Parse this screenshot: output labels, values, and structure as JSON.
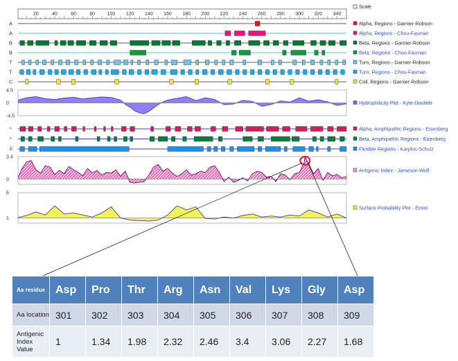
{
  "chart_data": {
    "type": "line",
    "sequence_axis": {
      "range": [
        1,
        350
      ],
      "ticks": [
        20,
        40,
        60,
        80,
        100,
        120,
        140,
        160,
        180,
        200,
        220,
        240,
        260,
        280,
        300,
        320,
        340
      ],
      "scale_label": "Scale"
    },
    "tracks": [
      {
        "letter": "A",
        "legend": "Alpha, Regions - Garnier-Robson",
        "color": "#e8141d",
        "legend_color": "#222222",
        "segments": [
          [
            253,
            258
          ]
        ]
      },
      {
        "letter": "A",
        "legend": "Alpha, Regions - Chou-Fasman",
        "color": "#e8147a",
        "legend_color": "#2b4fd6",
        "segments": [
          [
            221,
            227
          ],
          [
            231,
            242
          ],
          [
            246,
            264
          ]
        ]
      },
      {
        "letter": "B",
        "legend": "Beta, Regions - Garnier-Robson",
        "color": "#007a2e",
        "legend_color": "#222222",
        "segments": [
          [
            3,
            8
          ],
          [
            11,
            17
          ],
          [
            20,
            34
          ],
          [
            40,
            43
          ],
          [
            46,
            52
          ],
          [
            54,
            60
          ],
          [
            63,
            73
          ],
          [
            77,
            84
          ],
          [
            88,
            96
          ],
          [
            99,
            106
          ],
          [
            120,
            140
          ],
          [
            143,
            152
          ],
          [
            154,
            163
          ],
          [
            165,
            173
          ],
          [
            186,
            200
          ],
          [
            203,
            207
          ],
          [
            212,
            217
          ],
          [
            222,
            226
          ],
          [
            231,
            238
          ],
          [
            246,
            258
          ],
          [
            262,
            268
          ],
          [
            272,
            278
          ],
          [
            283,
            288
          ],
          [
            293,
            305
          ],
          [
            312,
            318
          ],
          [
            322,
            328
          ],
          [
            331,
            338
          ],
          [
            343,
            350
          ]
        ]
      },
      {
        "letter": "B",
        "legend": "Beta, Regions - Chou-Fasman",
        "color": "#0f9a3c",
        "legend_color": "#2b4fd6",
        "segments": [
          [
            120,
            137
          ],
          [
            228,
            233
          ],
          [
            236,
            248
          ],
          [
            282,
            286
          ],
          [
            291,
            307
          ],
          [
            316,
            320
          ],
          [
            324,
            327
          ]
        ]
      },
      {
        "letter": "T",
        "legend": "Turn, Regions - Garnier-Robson",
        "color": "#6cc4ee",
        "legend_color": "#222222",
        "segments": [
          [
            5,
            8
          ],
          [
            12,
            15
          ],
          [
            20,
            23
          ],
          [
            27,
            31
          ],
          [
            36,
            39
          ],
          [
            44,
            48
          ],
          [
            52,
            56
          ],
          [
            61,
            65
          ],
          [
            70,
            73
          ],
          [
            78,
            81
          ],
          [
            86,
            90
          ],
          [
            95,
            98
          ],
          [
            103,
            110
          ],
          [
            113,
            118
          ],
          [
            121,
            123
          ],
          [
            128,
            131
          ],
          [
            137,
            140
          ],
          [
            146,
            150
          ],
          [
            157,
            160
          ],
          [
            164,
            170
          ],
          [
            177,
            185
          ],
          [
            190,
            193
          ],
          [
            200,
            204
          ],
          [
            210,
            213
          ],
          [
            218,
            221
          ],
          [
            226,
            230
          ],
          [
            240,
            243
          ],
          [
            256,
            260
          ],
          [
            270,
            273
          ],
          [
            278,
            281
          ],
          [
            293,
            297
          ],
          [
            303,
            306
          ],
          [
            312,
            316
          ],
          [
            322,
            325
          ],
          [
            330,
            333
          ],
          [
            338,
            341
          ],
          [
            346,
            349
          ]
        ]
      },
      {
        "letter": "T",
        "legend": "Turn, Regions - Chou-Fasman",
        "color": "#1ea9e6",
        "legend_color": "#2b4fd6",
        "segments": [
          [
            3,
            7
          ],
          [
            10,
            14
          ],
          [
            17,
            20
          ],
          [
            24,
            29
          ],
          [
            33,
            37
          ],
          [
            40,
            44
          ],
          [
            47,
            52
          ],
          [
            55,
            60
          ],
          [
            63,
            67
          ],
          [
            71,
            75
          ],
          [
            79,
            84
          ],
          [
            87,
            90
          ],
          [
            94,
            97
          ],
          [
            100,
            108
          ],
          [
            112,
            116
          ],
          [
            119,
            124
          ],
          [
            128,
            132
          ],
          [
            136,
            140
          ],
          [
            143,
            149
          ],
          [
            153,
            158
          ],
          [
            163,
            170
          ],
          [
            174,
            178
          ],
          [
            182,
            186
          ],
          [
            190,
            193
          ],
          [
            197,
            202
          ],
          [
            206,
            210
          ],
          [
            214,
            219
          ],
          [
            223,
            228
          ],
          [
            232,
            236
          ],
          [
            240,
            244
          ],
          [
            248,
            252
          ],
          [
            256,
            260
          ],
          [
            264,
            268
          ],
          [
            272,
            276
          ],
          [
            280,
            284
          ],
          [
            288,
            292
          ],
          [
            296,
            300
          ],
          [
            304,
            308
          ],
          [
            312,
            316
          ],
          [
            320,
            324
          ],
          [
            328,
            332
          ],
          [
            336,
            340
          ],
          [
            344,
            348
          ]
        ]
      },
      {
        "letter": "C",
        "legend": "Coil, Regions - Garnier-Robson",
        "color": "#f0e43c",
        "legend_color": "#222222",
        "segments": [
          [
            9,
            12
          ],
          [
            42,
            46
          ],
          [
            58,
            62
          ],
          [
            104,
            108
          ],
          [
            162,
            166
          ],
          [
            189,
            193
          ],
          [
            224,
            228
          ],
          [
            264,
            268
          ],
          [
            290,
            294
          ],
          [
            338,
            341
          ]
        ]
      }
    ],
    "plots": [
      {
        "legend": "Hydrophilicity Plot - Kyte-Doolittle",
        "y_ticks": [
          "4.5",
          "0",
          "-4.5"
        ],
        "range": [
          -4.5,
          4.5
        ],
        "color": "#7b68ee",
        "fill": "solid",
        "x": [
          1,
          10,
          20,
          30,
          40,
          50,
          60,
          70,
          80,
          90,
          100,
          110,
          115,
          120,
          125,
          130,
          135,
          140,
          145,
          150,
          155,
          160,
          170,
          180,
          190,
          200,
          210,
          220,
          230,
          240,
          250,
          260,
          270,
          280,
          290,
          300,
          310,
          320,
          330,
          340,
          350
        ],
        "y": [
          1.0,
          1.8,
          2.2,
          1.5,
          1.2,
          1.7,
          2.0,
          1.4,
          1.8,
          2.1,
          1.9,
          1.0,
          -0.5,
          -1.5,
          -2.8,
          -3.5,
          -3.8,
          -3.0,
          -1.8,
          -0.6,
          0.4,
          1.0,
          1.6,
          2.2,
          0.8,
          1.8,
          1.2,
          -0.6,
          -0.4,
          0.9,
          0.5,
          -1.2,
          -0.6,
          0.7,
          0.3,
          1.8,
          0.6,
          1.1,
          0.4,
          -0.9,
          -0.3
        ]
      },
      {
        "legend": "Antigenic Index - Jameson-Wolf",
        "y_ticks": [
          "3.4",
          "0"
        ],
        "range": [
          -0.8,
          3.4
        ],
        "color": "#e2007a",
        "fill": "hatch",
        "x": [
          1,
          5,
          10,
          15,
          20,
          25,
          30,
          35,
          40,
          45,
          50,
          55,
          60,
          65,
          70,
          75,
          80,
          85,
          90,
          95,
          100,
          105,
          110,
          115,
          120,
          125,
          130,
          135,
          140,
          145,
          150,
          155,
          160,
          165,
          170,
          175,
          180,
          185,
          190,
          195,
          200,
          205,
          210,
          215,
          220,
          225,
          230,
          235,
          240,
          245,
          250,
          255,
          260,
          265,
          270,
          275,
          280,
          285,
          290,
          295,
          300,
          305,
          306,
          307,
          310,
          315,
          320,
          325,
          330,
          335,
          340,
          345,
          350
        ],
        "y": [
          0.2,
          1.5,
          2.6,
          2.8,
          1.4,
          0.9,
          2.0,
          1.8,
          0.7,
          1.3,
          0.8,
          1.9,
          1.4,
          1.0,
          0.5,
          1.6,
          0.9,
          1.3,
          0.6,
          1.0,
          0.9,
          1.4,
          0.4,
          1.2,
          -0.5,
          -0.6,
          -0.5,
          -0.4,
          0.6,
          1.8,
          2.2,
          1.2,
          1.6,
          0.9,
          0.4,
          0.8,
          1.4,
          0.6,
          0.8,
          1.2,
          1.0,
          1.8,
          2.0,
          1.0,
          -0.4,
          0.3,
          -0.5,
          -0.2,
          0.2,
          -0.3,
          0.8,
          1.2,
          1.0,
          0.3,
          0.4,
          -0.4,
          0.8,
          0.6,
          -0.1,
          0.8,
          1.0,
          2.46,
          3.4,
          3.06,
          2.3,
          0.8,
          1.6,
          -0.2,
          1.0,
          0.5,
          0.7,
          0.2,
          0.4
        ],
        "highlight_residue": 306
      },
      {
        "legend": "Surface Probability Plot - Emini",
        "y_ticks": [
          "6",
          "1"
        ],
        "range": [
          0,
          6
        ],
        "color": "#f2f03c",
        "fill": "solid",
        "x": [
          1,
          10,
          20,
          30,
          40,
          50,
          60,
          70,
          80,
          90,
          100,
          110,
          120,
          130,
          140,
          150,
          160,
          170,
          180,
          190,
          200,
          210,
          220,
          230,
          240,
          250,
          260,
          270,
          280,
          290,
          300,
          310,
          320,
          330,
          340,
          350
        ],
        "y": [
          1.1,
          1.5,
          2.2,
          1.6,
          3.4,
          1.8,
          2.0,
          1.6,
          1.2,
          2.0,
          3.2,
          1.0,
          0.6,
          0.5,
          0.4,
          0.6,
          1.6,
          3.4,
          2.6,
          3.2,
          0.9,
          0.8,
          1.2,
          1.0,
          1.5,
          1.8,
          1.2,
          1.4,
          1.2,
          1.6,
          1.4,
          2.6,
          2.0,
          1.2,
          1.8,
          1.0
        ]
      }
    ],
    "amphipathic_tracks": [
      {
        "letter": "*",
        "legend": "Alpha, Amphipathic Regions - Eisenberg",
        "color": "#d21f5c",
        "segments": [
          [
            3,
            9
          ],
          [
            12,
            17
          ],
          [
            22,
            26
          ],
          [
            32,
            35
          ],
          [
            40,
            45
          ],
          [
            50,
            53
          ],
          [
            58,
            63
          ],
          [
            70,
            72
          ],
          [
            82,
            84
          ],
          [
            92,
            94
          ],
          [
            100,
            102
          ],
          [
            111,
            116
          ],
          [
            120,
            125
          ],
          [
            142,
            145
          ],
          [
            158,
            163
          ],
          [
            168,
            174
          ],
          [
            181,
            186
          ],
          [
            189,
            195
          ],
          [
            206,
            211
          ],
          [
            218,
            224
          ],
          [
            232,
            240
          ],
          [
            243,
            262
          ],
          [
            265,
            278
          ],
          [
            282,
            290
          ],
          [
            296,
            308
          ],
          [
            312,
            325
          ],
          [
            330,
            336
          ],
          [
            340,
            350
          ]
        ]
      },
      {
        "letter": "*",
        "legend": "Beta, Amphipathic Regions - Eisenberg",
        "color": "#00823a",
        "segments": [
          [
            4,
            8
          ],
          [
            12,
            16
          ],
          [
            22,
            28
          ],
          [
            36,
            40
          ],
          [
            44,
            47
          ],
          [
            62,
            65
          ],
          [
            85,
            88
          ],
          [
            96,
            99
          ],
          [
            103,
            106
          ],
          [
            113,
            117
          ],
          [
            120,
            123
          ],
          [
            141,
            146
          ],
          [
            150,
            160
          ],
          [
            164,
            168
          ],
          [
            176,
            180
          ],
          [
            188,
            208
          ],
          [
            214,
            218
          ],
          [
            240,
            250
          ],
          [
            256,
            262
          ],
          [
            270,
            290
          ],
          [
            292,
            300
          ],
          [
            314,
            318
          ],
          [
            322,
            326
          ],
          [
            330,
            338
          ],
          [
            343,
            348
          ]
        ]
      },
      {
        "letter": "F",
        "legend": "Flexible Regions - Karplus-Schulz",
        "color": "#1e90e8",
        "segments": [
          [
            3,
            8
          ],
          [
            12,
            21
          ],
          [
            24,
            119
          ],
          [
            160,
            198
          ],
          [
            202,
            206
          ],
          [
            209,
            213
          ],
          [
            217,
            221
          ],
          [
            226,
            230
          ],
          [
            234,
            252
          ],
          [
            256,
            260
          ],
          [
            264,
            280
          ],
          [
            284,
            287
          ],
          [
            293,
            306
          ],
          [
            310,
            315
          ],
          [
            318,
            320
          ],
          [
            330,
            333
          ],
          [
            343,
            350
          ]
        ]
      }
    ]
  },
  "table": {
    "header_label": "Aa residue",
    "residues": [
      "Asp",
      "Pro",
      "Thr",
      "Arg",
      "Asn",
      "Val",
      "Lys",
      "Gly",
      "Asp"
    ],
    "location_label": "Aa location",
    "locations": [
      "301",
      "302",
      "303",
      "304",
      "305",
      "306",
      "307",
      "308",
      "309"
    ],
    "value_label": "Antigenic Index Value",
    "values": [
      "1",
      "1.34",
      "1.98",
      "2.32",
      "2.46",
      "3.4",
      "3.06",
      "2.27",
      "1.68"
    ]
  }
}
